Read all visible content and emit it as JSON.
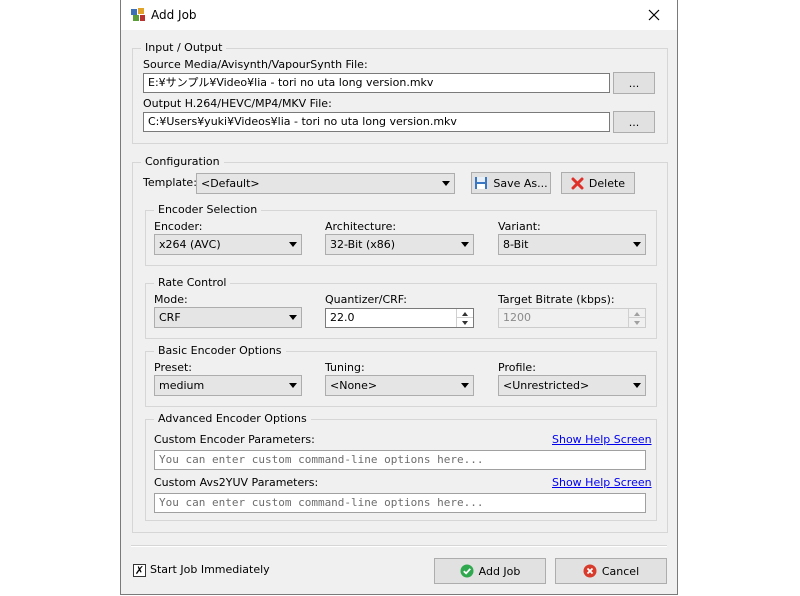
{
  "window": {
    "title": "Add Job"
  },
  "io": {
    "legend": "Input / Output",
    "source_label": "Source Media/Avisynth/VapourSynth File:",
    "source_value": "E:¥サンプル¥Video¥lia - tori no uta long version.mkv",
    "output_label": "Output H.264/HEVC/MP4/MKV File:",
    "output_value": "C:¥Users¥yuki¥Videos¥lia - tori no uta long version.mkv",
    "browse_label": "..."
  },
  "config": {
    "legend": "Configuration",
    "template_label": "Template:",
    "template_value": "<Default>",
    "save_as_label": "Save As...",
    "delete_label": "Delete"
  },
  "encoder": {
    "legend": "Encoder Selection",
    "encoder_label": "Encoder:",
    "encoder_value": "x264 (AVC)",
    "arch_label": "Architecture:",
    "arch_value": "32-Bit (x86)",
    "variant_label": "Variant:",
    "variant_value": "8-Bit"
  },
  "rate": {
    "legend": "Rate Control",
    "mode_label": "Mode:",
    "mode_value": "CRF",
    "crf_label": "Quantizer/CRF:",
    "crf_value": "22.0",
    "bitrate_label": "Target Bitrate (kbps):",
    "bitrate_value": "1200"
  },
  "basic": {
    "legend": "Basic Encoder Options",
    "preset_label": "Preset:",
    "preset_value": "medium",
    "tuning_label": "Tuning:",
    "tuning_value": "<None>",
    "profile_label": "Profile:",
    "profile_value": "<Unrestricted>"
  },
  "advanced": {
    "legend": "Advanced Encoder Options",
    "custom_encoder_label": "Custom Encoder Parameters:",
    "custom_avs_label": "Custom Avs2YUV Parameters:",
    "help_link": "Show Help Screen",
    "placeholder": "You can enter custom command-line options here..."
  },
  "footer": {
    "start_immediately_label": "Start Job Immediately",
    "start_immediately_checked": true,
    "add_job_label": "Add Job",
    "cancel_label": "Cancel"
  },
  "colors": {
    "ok_green": "#2fa84f",
    "cancel_red": "#d83b2b",
    "delete_red": "#e0302a",
    "link_blue": "#0000ee"
  }
}
